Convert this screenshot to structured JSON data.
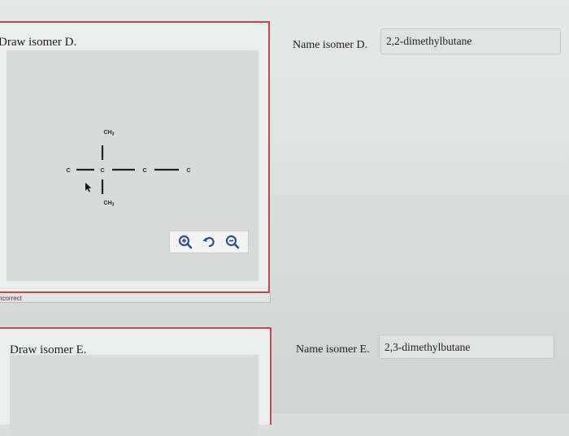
{
  "isomer_d": {
    "prompt": "Draw isomer D.",
    "structure": {
      "atoms": [
        "C",
        "C",
        "C",
        "C",
        "CH3",
        "CH3"
      ],
      "cursor_icon": "arrow-cursor-icon"
    },
    "toolbar": [
      "zoom-in-icon",
      "undo-icon",
      "zoom-out-icon"
    ],
    "feedback": "ncorrect",
    "name_label": "Name isomer D.",
    "name_value": "2,2-dimethylbutane"
  },
  "isomer_e": {
    "prompt": "Draw isomer E.",
    "name_label": "Name isomer E.",
    "name_value": "2,3-dimethylbutane"
  },
  "colors": {
    "panel_border": "#b84a5c",
    "canvas": "#d9dbda",
    "toolbar_icon": "#2f4f86"
  }
}
